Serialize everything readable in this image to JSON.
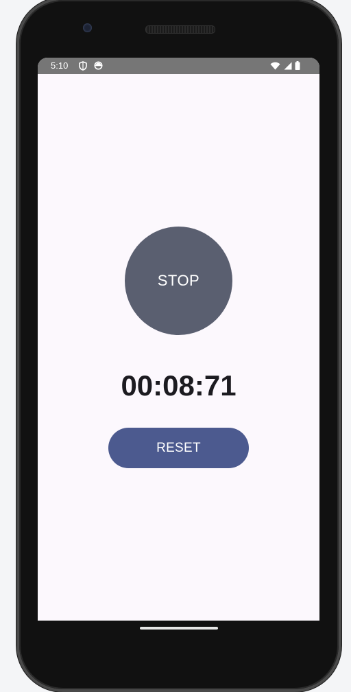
{
  "status_bar": {
    "time": "5:10",
    "left_icons": [
      "shield-icon",
      "circle-status-icon"
    ],
    "right_icons": [
      "wifi-icon",
      "signal-icon",
      "battery-icon"
    ]
  },
  "stopwatch": {
    "stop_label": "STOP",
    "elapsed": "00:08:71",
    "reset_label": "RESET"
  },
  "colors": {
    "screen_background": "#fcf8fd",
    "stop_button": "#5a5f70",
    "reset_button": "#4c5a8f",
    "timer_text": "#1c1b20",
    "status_bar": "#767676"
  }
}
